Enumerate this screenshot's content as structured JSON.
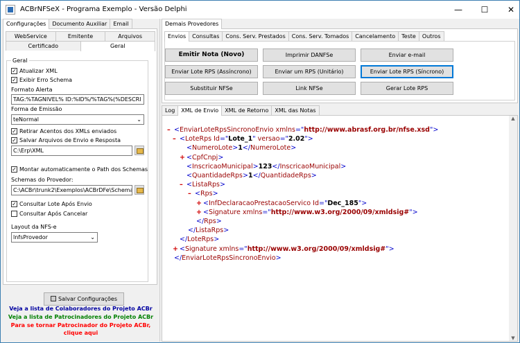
{
  "window": {
    "title": "ACBrNFSeX - Programa Exemplo - Versão Delphi"
  },
  "controls": {
    "minimize": "—",
    "maximize": "☐",
    "close": "✕"
  },
  "left": {
    "tabs_row1": [
      "Configurações",
      "Documento Auxiliar",
      "Email"
    ],
    "tabs_row2": [
      "WebService",
      "Emitente",
      "Arquivos"
    ],
    "tabs_row3": [
      "Certificado",
      "Geral"
    ],
    "group_title": "Geral",
    "atualizar_xml": "Atualizar XML",
    "exibir_erro": "Exibir Erro Schema",
    "formato_alerta_label": "Formato Alerta",
    "formato_alerta_value": "TAG:%TAGNIVEL% ID:%ID%/%TAG%(%DESCRI",
    "forma_emissao_label": "Forma de Emissão",
    "forma_emissao_value": "teNormal",
    "retirar_acentos": "Retirar Acentos dos XMLs enviados",
    "salvar_arquivos": "Salvar Arquivos de Envio e Resposta",
    "path_value": "C:\\Erp\\XML",
    "montar_path": "Montar automaticamente o Path dos Schemas",
    "schemas_label": "Schemas do Provedor:",
    "schemas_value": "C:\\ACBr\\trunk2\\Exemplos\\ACBrDFe\\Schemas\\I",
    "consultar_lote": "Consultar Lote Após Envio",
    "consultar_cancelar": "Consultar Após Cancelar",
    "layout_label": "Layout da NFS-e",
    "layout_value": "lnfsProvedor",
    "salvar_button": "Salvar Configurações",
    "link1": "Veja a lista de Colaboradores do Projeto ACBr",
    "link2": "Veja a lista de Patrocinadores do Projeto ACBr",
    "link3": "Para se tornar Patrocinador do Projeto ACBr, clique aqui",
    "colors": {
      "link1": "#0000a0",
      "link2": "#008000",
      "link3": "#ff0000"
    }
  },
  "right": {
    "top_tab": "Demais Provedores",
    "tabs": [
      "Envios",
      "Consultas",
      "Cons. Serv. Prestados",
      "Cons. Serv. Tomados",
      "Cancelamento",
      "Teste",
      "Outros"
    ],
    "buttons": [
      "Emitir Nota (Novo)",
      "Imprimir DANFSe",
      "Enviar e-mail",
      "Enviar Lote RPS (Assíncrono)",
      "Enviar um RPS (Unitário)",
      "Enviar Lote RPS (Síncrono)",
      "Substituir NFSe",
      "Link NFSe",
      "Gerar Lote RPS"
    ],
    "bottom_tabs": [
      "Log",
      "XML de Envio",
      "XML de Retorno",
      "XML das Notas"
    ]
  },
  "xml": {
    "root_tag": "EnviarLoteRpsSincronoEnvio",
    "ns_attr": "xmlns",
    "ns_url": "http://www.abrasf.org.br/nfse.xsd",
    "lote_tag": "LoteRps",
    "id_attr": "Id",
    "lote_id": "Lote_1",
    "versao_attr": "versao",
    "versao": "2.02",
    "numero_tag": "NumeroLote",
    "numero_value": "1",
    "cpf_tag": "CpfCnpj",
    "inscricao_tag": "InscricaoMunicipal",
    "inscricao_value": "123",
    "qtd_tag": "QuantidadeRps",
    "qtd_value": "1",
    "lista_tag": "ListaRps",
    "rps_tag": "Rps",
    "inf_tag": "InfDeclaracaoPrestacaoServico",
    "inf_id": "Dec_185",
    "sig_tag": "Signature",
    "sig_ns": "http://www.w3.org/2000/09/xmldsig#"
  }
}
